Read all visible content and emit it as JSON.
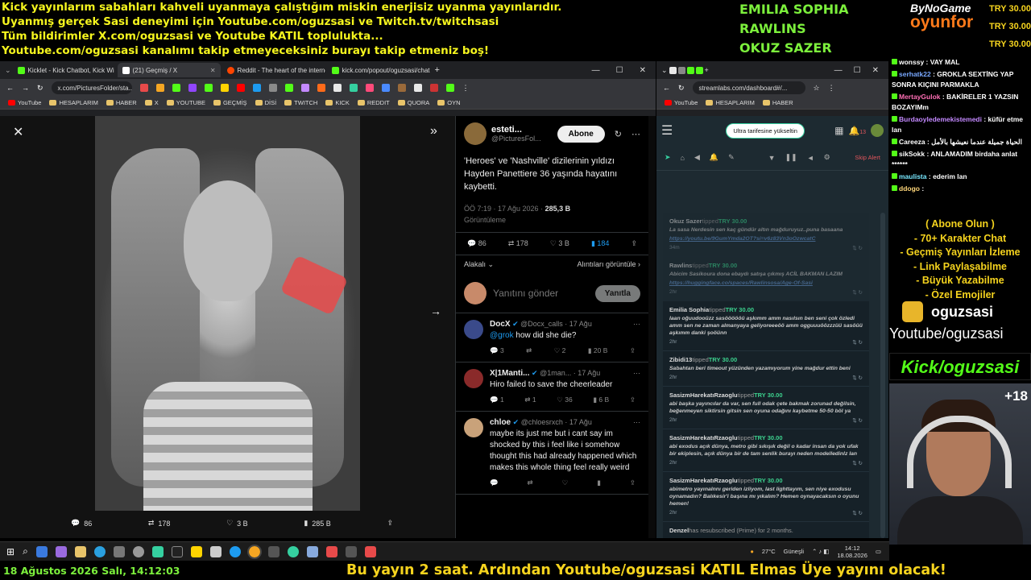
{
  "banner": {
    "lines": [
      "Kick yayınlarım sabahları kahveli uyanmaya çalıştığım miskin enerjisiz uyanma yayınlarıdır.",
      "Uyanmış gerçek Sasi deneyimi için Youtube.com/oguzsasi ve Twitch.tv/twitchsasi",
      "Tüm bildirimler X.com/oguzsasi ve Youtube KATIL toplulukta...",
      "Youtube.com/oguzsasi kanalımı takip etmeyeceksiniz burayı takip etmeniz boş!"
    ],
    "names": [
      "EMILIA SOPHIA",
      "RAWLINS",
      "OKUZ SAZER"
    ],
    "logo_top": "ByNoGame",
    "logo_bottom": "oyunfor",
    "try": [
      "TRY 30.00",
      "TRY 30.00",
      "TRY 30.00"
    ]
  },
  "browser_left": {
    "tabs": [
      {
        "label": "Kicklet - Kick Chatbot, Kick Wi",
        "color": "#53fc18"
      },
      {
        "label": "(21) Geçmiş / X",
        "color": "#ffffff"
      },
      {
        "label": "Reddit - The heart of the interne",
        "color": "#ff4500"
      },
      {
        "label": "kick.com/popout/oguzsasi/chat",
        "color": "#53fc18"
      }
    ],
    "url": "x.com/PicturesFolder/sta...",
    "bookmarks": [
      "YouTube",
      "HESAPLARIM",
      "HABER",
      "X",
      "YOUTUBE",
      "GEÇMİŞ",
      "DİSİ",
      "TWITCH",
      "KICK",
      "REDDIT",
      "QUORA",
      "OYN"
    ]
  },
  "tweet": {
    "author_name": "esteti...",
    "author_handle": "@PicturesFol...",
    "follow_label": "Abone",
    "text": "'Heroes' ve 'Nashville' dizilerinin yıldızı Hayden Panettiere 36 yaşında hayatını kaybetti.",
    "time": "ÖÖ 7:19 · 17 Ağu 2026 ·",
    "views": "285,3 B",
    "views_label": "Görüntüleme",
    "replies": "86",
    "retweets": "178",
    "likes": "3 B",
    "bookmarks": "184",
    "sort_left": "Alakalı",
    "sort_right": "Alıntıları görüntüle",
    "reply_placeholder": "Yanıtını gönder",
    "reply_button": "Yanıtla",
    "photo_stats": {
      "replies": "86",
      "retweets": "178",
      "likes": "3 B",
      "views": "285 B"
    }
  },
  "replies": [
    {
      "name": "DocX",
      "handle": "@Docx_calls · 17 Ağu",
      "mention": "@grok",
      "text": "how did she die?",
      "r": "3",
      "rt": "",
      "l": "2",
      "v": "20 B",
      "avatar": "#3a4a8a"
    },
    {
      "name": "X|1Manti...",
      "handle": "@1man... · 17 Ağu",
      "mention": "",
      "text": "Hiro failed to save the cheerleader",
      "r": "1",
      "rt": "1",
      "l": "36",
      "v": "6 B",
      "avatar": "#8a2a2a"
    },
    {
      "name": "chloe",
      "handle": "@chloesrxch · 17 Ağu",
      "mention": "",
      "text": "maybe its just me but i cant say im shocked by this i feel like i somehow thought this had already happened which makes this whole thing feel really weird",
      "r": "",
      "rt": "",
      "l": "",
      "v": "",
      "avatar": "#c9a27a"
    }
  ],
  "browser_right": {
    "url": "streamlabs.com/dashboard#/...",
    "bookmarks": [
      "YouTube",
      "HESAPLARIM",
      "HABER"
    ],
    "ultra_label": "Ultra tarifesine yükseltin",
    "skip_label": "Skip Alert",
    "notif_count": "13"
  },
  "alerts": [
    {
      "user": "Okuz Sazer",
      "tip": "tipped",
      "amount": "TRY 30.00",
      "msg": "La sasa Nerdesin sen kaç gündür altın mağduruyuz..puna basaana",
      "link": "https://youtu.be/9GumYmda2OT?si=v6z83Vn3oOzwcatC",
      "time": "34m",
      "faded": true
    },
    {
      "user": "Rawlins",
      "tip": "tipped",
      "amount": "TRY 30.00",
      "msg": "Abicim Sasikoura dona ebaydı satışa çıkmış ACİL BAKMAN LAZIM",
      "link": "https://huggingface.co/spaces/Rawlinsosa/Age-Of-Sasi",
      "time": "2hr",
      "faded": true
    },
    {
      "user": "Emilia Sophia",
      "tip": "tipped",
      "amount": "TRY 30.00",
      "msg": "laan oğuudooüzz sasöööööü aşkımm amm nasılsın ben seni çok özledi amm sen ne zaman almanyaya geliyoreeeöö amm ogguuuöözzzüü sasöüü aşkımm danki şoöünn",
      "link": "",
      "time": "2hr",
      "faded": false
    },
    {
      "user": "Zibidi13",
      "tip": "tipped",
      "amount": "TRY 30.00",
      "msg": "Sabahtan beri timeout yüzünden yazamıyorum yine mağdur ettin beni",
      "link": "",
      "time": "2hr",
      "faded": false
    },
    {
      "user": "SasizmHarekatıRzaoglu",
      "tip": "tipped",
      "amount": "TRY 30.00",
      "msg": "abi başka yayıncılar da var, sen full odak çete bakmak zorunad değilsin, beğenmeyen siktirsin gitsin sen oyuna odağını kaybetme 50-50 böl ya",
      "link": "",
      "time": "2hr",
      "faded": false
    },
    {
      "user": "SasizmHarekatıRzaoglu",
      "tip": "tipped",
      "amount": "TRY 30.00",
      "msg": "abi exodus açık dünya, metro gibi sıkışık değil o kadar insan da yok ufak bir ekiplesin, açık dünya bir de tam senlik burayı neden modelledinlz lan",
      "link": "",
      "time": "2hr",
      "faded": false
    },
    {
      "user": "SasizmHarekatıRzaoglu",
      "tip": "tipped",
      "amount": "TRY 30.00",
      "msg": "abimetro yayınalnnı geriden izliyom, last lighttayım, sen niye exodusu oynamadın? Balıkesir'i başına mı yıkalım? Hemen oynayacaksın o oyunu hemen!",
      "link": "",
      "time": "2hr",
      "faded": false
    },
    {
      "user": "Denzel",
      "tip": "has resubscribed (Prime) for 2 months.",
      "amount": "",
      "msg": "",
      "link": "",
      "time": "",
      "faded": false
    }
  ],
  "chat": [
    {
      "user": "wonssy",
      "text": "VAY MAL",
      "color": "#ffffff"
    },
    {
      "user": "serhatk22",
      "text": "GROKLA SEXTİNG YAP SONRA KIÇINI PARMAKLA",
      "color": "#78a8ff"
    },
    {
      "user": "MertayGulok",
      "text": "BAKİRELER 1 YAZSIN BOZAYIMm",
      "color": "#ff6fb5"
    },
    {
      "user": "Burdaoyledemekistemedi",
      "text": "küfür etme lan",
      "color": "#c389ff"
    },
    {
      "user": "Careeza",
      "text": "الحياة جميلة عندما نعيشها بالأمل",
      "color": "#ffffff"
    },
    {
      "user": "sikSokk",
      "text": "ANLAMADIM birdaha anlat ******",
      "color": "#ffffff"
    },
    {
      "user": "maulista",
      "text": "ederim lan",
      "color": "#78e8ff"
    },
    {
      "user": "ddogo",
      "text": "",
      "color": "#ffd77a"
    }
  ],
  "perks": [
    "( Abone Olun )",
    "- 70+ Karakter Chat",
    "- Geçmiş Yayınları İzleme",
    "- Link Paylaşabilme",
    "- Büyük Yazabilme",
    "- Özel Emojiler"
  ],
  "channel": {
    "name": "oguzsasi",
    "yt": "Youtube/oguzsasi",
    "kick": "Kick/oguzsasi",
    "viewers": "+18"
  },
  "taskbar": {
    "weather": "27°C",
    "weather_label": "Güneşli",
    "time": "14:12",
    "date": "18.08.2026"
  },
  "footer": {
    "date": "18 Ağustos 2026 Salı, 14:12:03",
    "ticker": "Bu yayın 2 saat. Ardından Youtube/oguzsasi KATIL Elmas Üye yayını olacak!"
  }
}
